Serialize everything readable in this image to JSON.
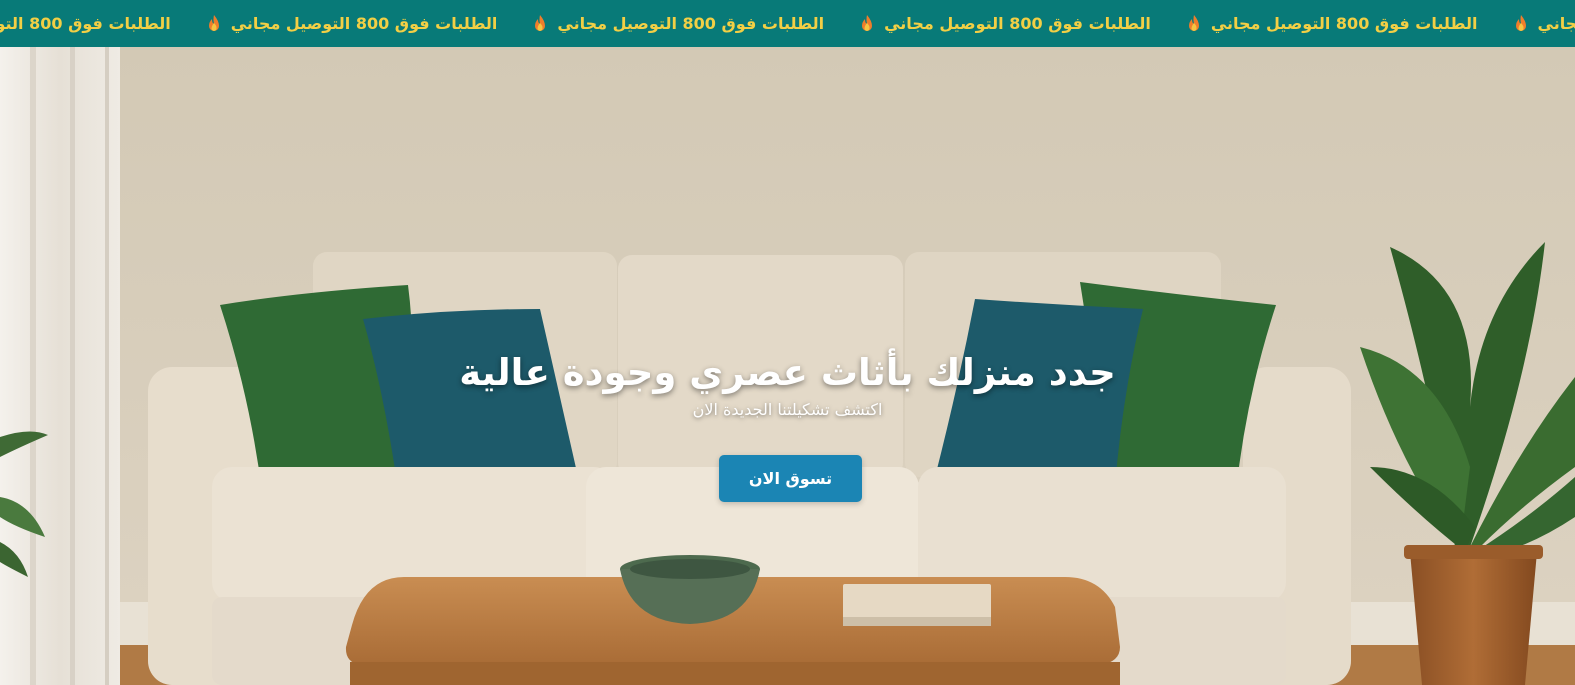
{
  "announcement": {
    "text": "الطلبات فوق 800 التوصيل مجاني",
    "repeat_count": 6,
    "icon": "fire-icon",
    "background": "#087a78",
    "text_color": "#f2cf45"
  },
  "hero": {
    "title": "جدد منزلك بأثاث عصري وجودة عالية",
    "subtitle": "اكتشف تشكيلتنا الجديدة الان",
    "cta_label": "تسوق الان",
    "cta_color": "#1b85b4"
  }
}
